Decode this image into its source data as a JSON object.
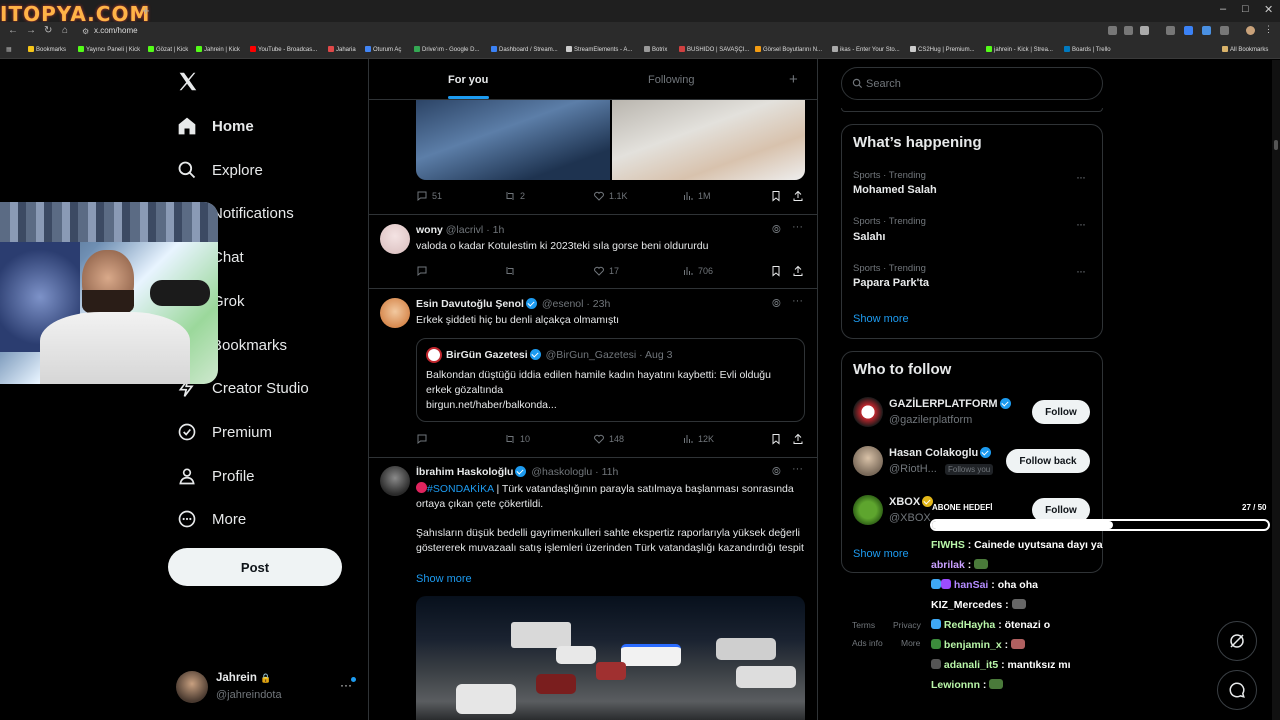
{
  "browser": {
    "logo_text": "ITOPYA.COM",
    "new_tab_symbol": "+",
    "url": "x.com/home",
    "bookmarks": [
      {
        "label": "Bookmarks",
        "color": "#f5c518"
      },
      {
        "label": "Yayıncı Paneli | Kick",
        "color": "#53fc18"
      },
      {
        "label": "Gözat | Kick",
        "color": "#53fc18"
      },
      {
        "label": "Jahrein | Kick",
        "color": "#53fc18"
      },
      {
        "label": "YouTube - Broadcas...",
        "color": "#ff0000"
      },
      {
        "label": "Jaharia",
        "color": "#e04848"
      },
      {
        "label": "Oturum Aç",
        "color": "#4285f4"
      },
      {
        "label": "Drive'ım - Google D...",
        "color": "#34a853"
      },
      {
        "label": "Dashboard / Stream...",
        "color": "#3b82f6"
      },
      {
        "label": "StreamElements - A...",
        "color": "#cccccc"
      },
      {
        "label": "Botrix",
        "color": "#999999"
      },
      {
        "label": "BUSHIDO | SAVAŞÇI...",
        "color": "#d04040"
      },
      {
        "label": "Görsel Boyutlarını N...",
        "color": "#f39c12"
      },
      {
        "label": "ikas - Enter Your Sto...",
        "color": "#aaaaaa"
      },
      {
        "label": "CS2Hug | Premium...",
        "color": "#cccccc"
      },
      {
        "label": "jahrein - Kick | Strea...",
        "color": "#53fc18"
      },
      {
        "label": "Boards | Trello",
        "color": "#0079bf"
      }
    ],
    "all_bookmarks": "All Bookmarks"
  },
  "nav": {
    "items": [
      {
        "label": "Home",
        "icon": "home-icon"
      },
      {
        "label": "Explore",
        "icon": "search-icon"
      },
      {
        "label": "Notifications",
        "icon": "bell-icon"
      },
      {
        "label": "Chat",
        "icon": "mail-icon"
      },
      {
        "label": "Grok",
        "icon": "grok-icon"
      },
      {
        "label": "Bookmarks",
        "icon": "bookmark-icon"
      },
      {
        "label": "Creator Studio",
        "icon": "lightning-icon"
      },
      {
        "label": "Premium",
        "icon": "premium-icon"
      },
      {
        "label": "Profile",
        "icon": "person-icon"
      },
      {
        "label": "More",
        "icon": "more-circle-icon"
      }
    ],
    "post_label": "Post",
    "account": {
      "name": "Jahrein",
      "handle": "@jahreindota"
    }
  },
  "timeline": {
    "tabs": {
      "for_you": "For you",
      "following": "Following"
    },
    "tweet0_stats": {
      "replies": "51",
      "reposts": "2",
      "likes": "1.1K",
      "views": "1M"
    },
    "tweets": [
      {
        "name": "wony",
        "handle": "@lacrivl",
        "time": "· 1h",
        "text": "valoda o kadar Kotulestim ki 2023teki sıla gorse beni oldururdu",
        "replies": "",
        "reposts": "",
        "likes": "17",
        "views": "706"
      },
      {
        "name": "Esin Davutoğlu Şenol",
        "handle": "@esenol",
        "time": "· 23h",
        "text": "Erkek şiddeti hiç bu denli alçakça olmamıştı",
        "quote": {
          "name": "BirGün Gazetesi",
          "handle": "@BirGun_Gazetesi",
          "time": "· Aug 3",
          "text": "Balkondan düştüğü iddia edilen hamile kadın hayatını kaybetti: Evli olduğu erkek gözaltında",
          "link": "birgun.net/haber/balkonda..."
        },
        "replies": "",
        "reposts": "10",
        "likes": "148",
        "views": "12K"
      },
      {
        "name": "İbrahim Haskoloğlu",
        "handle": "@haskologlu",
        "time": "· 11h",
        "hashtag": "#SONDAKİKA",
        "text1": " | Türk vatandaşlığının parayla satılmaya başlanması sonrasında ortaya çıkan çete çökertildi.",
        "text2": "Şahısların düşük bedelli gayrimenkulleri sahte ekspertiz raporlarıyla yüksek değerli göstererek muvazaalı satış işlemleri üzerinden Türk vatandaşlığı kazandırdığı tespit",
        "show_more": "Show more"
      }
    ]
  },
  "sidebar": {
    "search_placeholder": "Search",
    "happening_title": "What’s happening",
    "trends": [
      {
        "meta": "Sports · Trending",
        "name": "Mohamed Salah"
      },
      {
        "meta": "Sports · Trending",
        "name": "Salahı"
      },
      {
        "meta": "Sports · Trending",
        "name": "Papara Park'ta"
      }
    ],
    "show_more": "Show more",
    "wtf_title": "Who to follow",
    "follow": [
      {
        "name": "GAZİLERPLATFORM",
        "handle": "@gazilerplatform",
        "button": "Follow"
      },
      {
        "name": "Hasan Colakoglu",
        "handle": "@RiotH...",
        "badge": "Follows you",
        "button": "Follow back"
      },
      {
        "name": "XBOX",
        "handle": "@XBOX",
        "button": "Follow"
      }
    ],
    "wtf_show_more": "Show more",
    "footer": [
      "Terms",
      "Privacy",
      "Ads info",
      "More"
    ]
  },
  "stream_overlay": {
    "goal_label": "ABONE HEDEFİ",
    "goal_count": "27 / 50",
    "goal_fraction": 0.54,
    "chat": [
      {
        "user": "FIWHS",
        "color": "#b9f6a9",
        "msg": ": Cainede uyutsana dayı ya"
      },
      {
        "user": "abrilak",
        "color": "#c9a0ff",
        "msg": ":"
      },
      {
        "user": "hanSai",
        "color": "#b48cff",
        "msg": ": oha oha"
      },
      {
        "user": "KIZ_Mercedes",
        "color": "#ffffff",
        "msg": ":"
      },
      {
        "user": "RedHayha",
        "color": "#b9f6a9",
        "msg": ": ötenazi o"
      },
      {
        "user": "benjamin_x",
        "color": "#b9f6a9",
        "msg": ":"
      },
      {
        "user": "adanali_it5",
        "color": "#b9f6a9",
        "msg": ": mantıksız mı"
      },
      {
        "user": "Lewionnn",
        "color": "#b9f6a9",
        "msg": ":"
      }
    ]
  },
  "colors": {
    "accent": "#1d9bf0",
    "bg": "#000000",
    "text": "#e7e9ea",
    "muted": "#71767b",
    "border": "#2f3336"
  }
}
